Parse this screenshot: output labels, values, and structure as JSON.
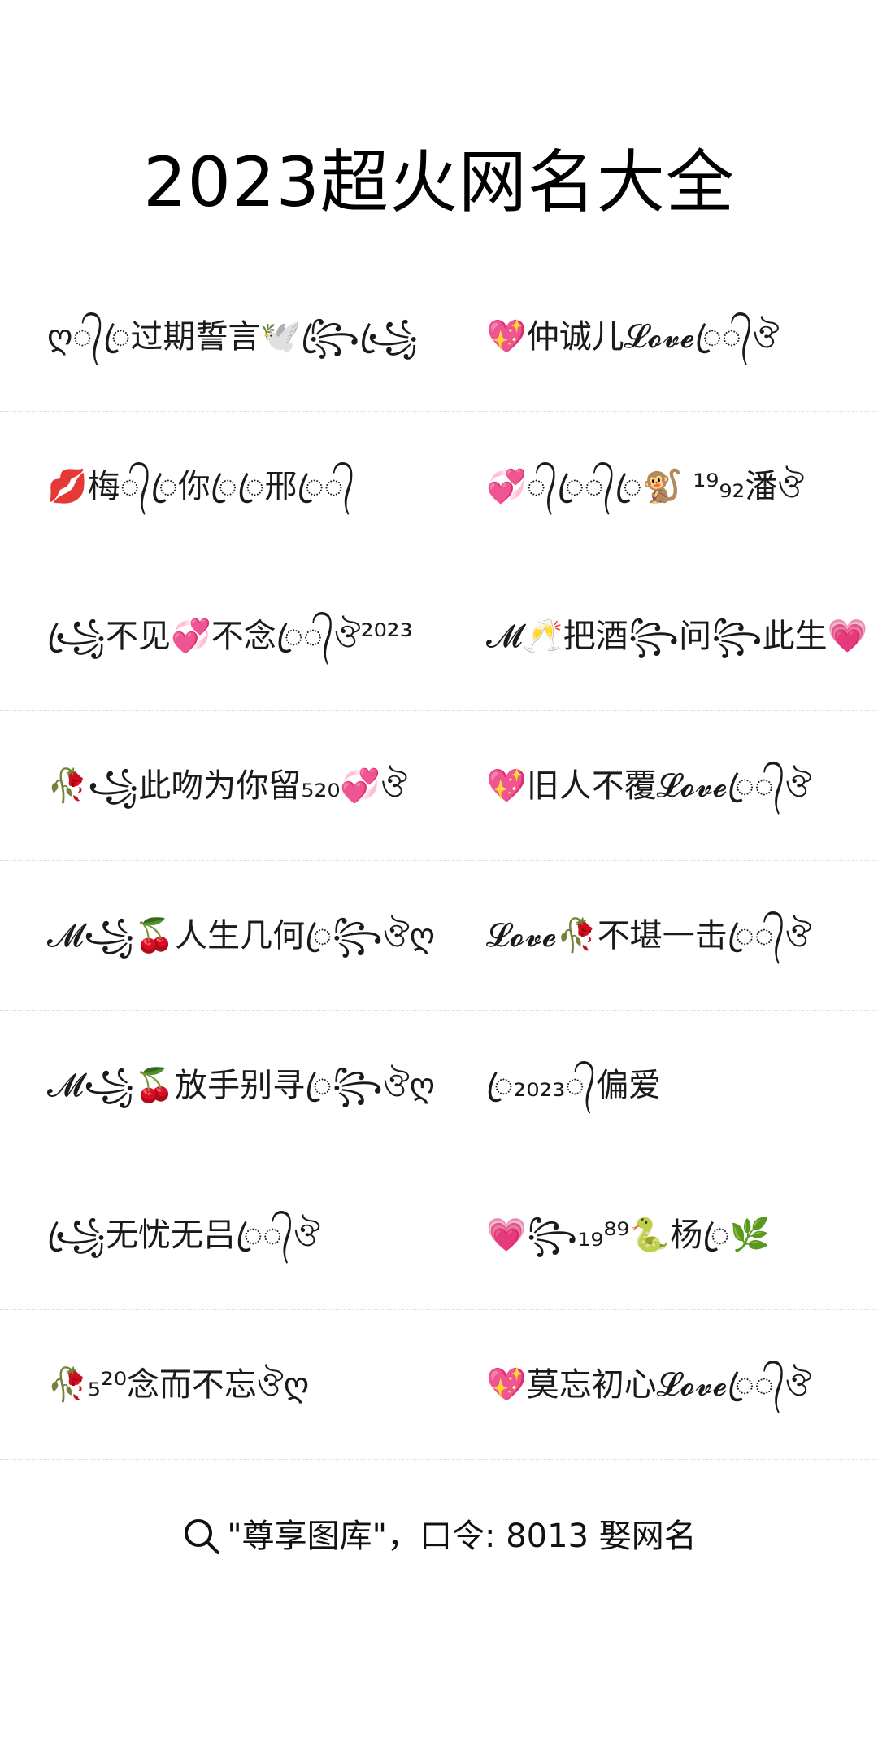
{
  "title": "2023超火网名大全",
  "names": [
    {
      "left": "ღ᭄ꦿ过期誓言🕊️꧂ꦿ꧁ꦿ",
      "right": "💖仲诚儿𝓛𝓸𝓿𝓮ꦿ᭄ঔ"
    },
    {
      "left": "💋梅᭄ꦿ你ꦿꦿ邢ꦿ᭄",
      "right": "💞᭄ꦿ᭄ꦿ🐒 ¹⁹₉₂潘ঔ"
    },
    {
      "left": "꧁ꦿ不见💞不念ꦿ᭄ঔ²⁰²³",
      "right": "𝓜🥂把酒꧂问꧂此生💗"
    },
    {
      "left": "🥀꧁此吻为你留₅₂₀💞ঔ",
      "right": "💖旧人不覆𝓛𝓸𝓿𝓮ꦿ᭄ঔ"
    },
    {
      "left": "𝓜꧁🍒人生几何ꦿ꧂ঔღ",
      "right": "𝓛𝓸𝓿𝓮🥀不堪一击ꦿ᭄ঔ"
    },
    {
      "left": "𝓜꧁🍒放手别寻ꦿ꧂ঔღ",
      "right": "ꦿ₂₀₂₃᭄偏爱"
    },
    {
      "left": "꧁ꦿ无忧无吕ꦿ᭄ঔ",
      "right": "💗꧂₁₉⁸⁹🐍杨ꦿ🌿"
    },
    {
      "left": "🥀₅²⁰念而不忘ঔღ",
      "right": "💖莫忘初心𝓛𝓸𝓿𝓮ꦿ᭄ঔ"
    }
  ],
  "footer": {
    "icon": "search-icon",
    "text": "\"尊享图库\"，口令: 8013 娶网名"
  }
}
